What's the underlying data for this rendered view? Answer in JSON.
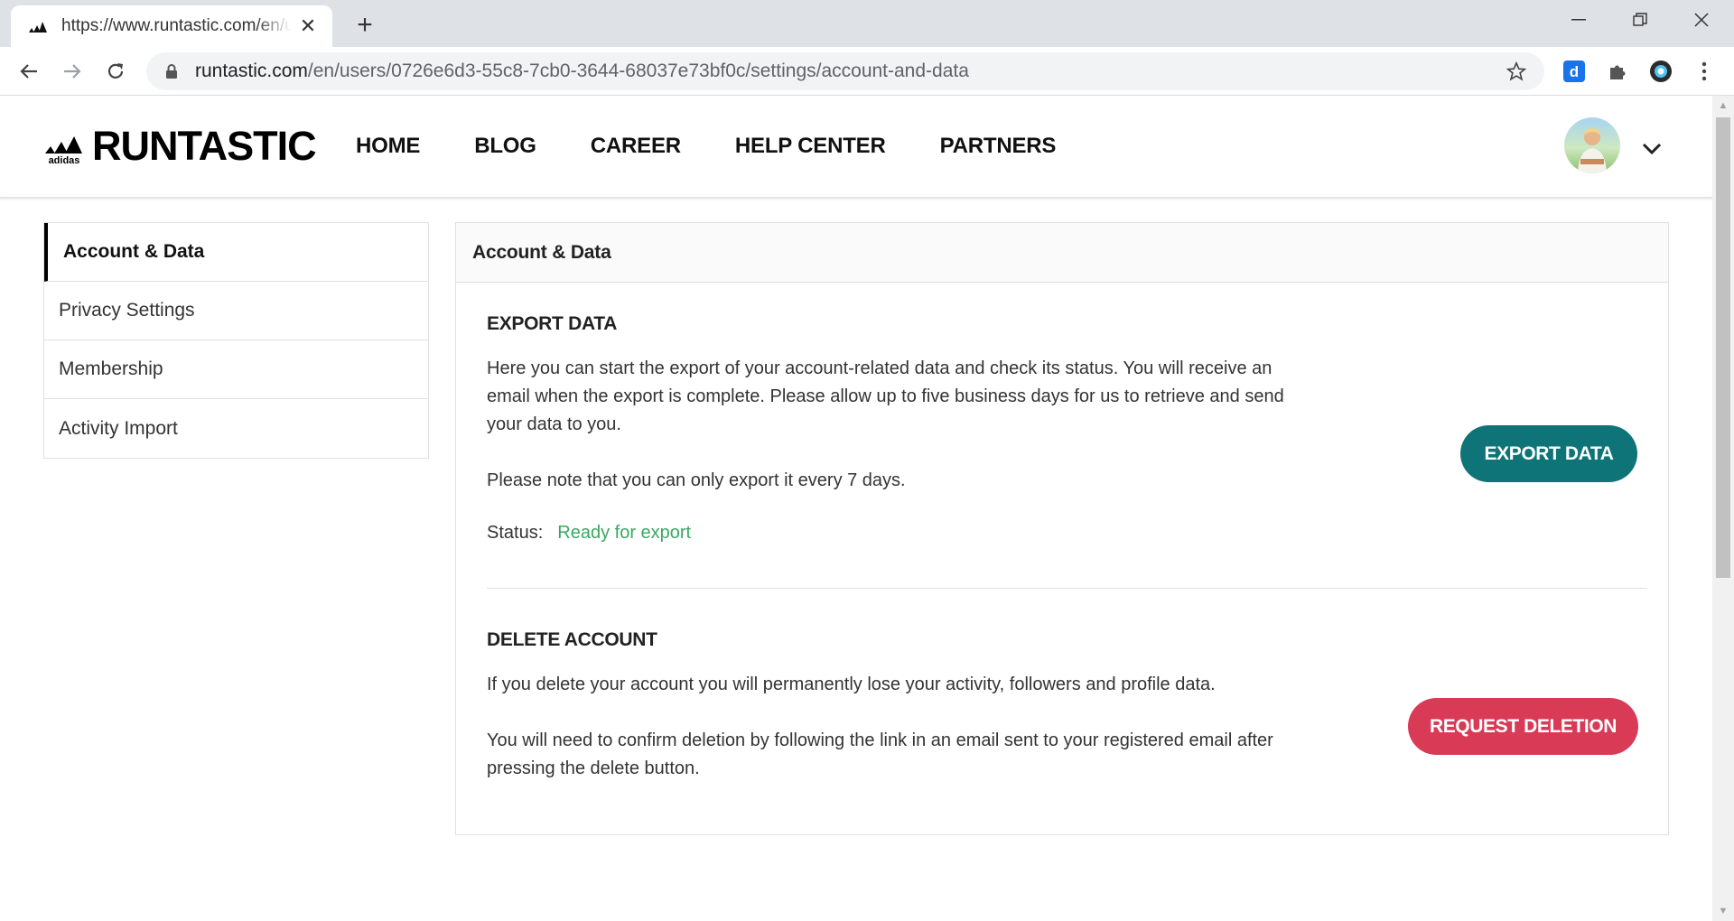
{
  "browser": {
    "tab_title": "https://www.runtastic.com/en/users/0726e6d3",
    "url_host": "runtastic.com",
    "url_path": "/en/users/0726e6d3-55c8-7cb0-3644-68037e73bf0c/settings/account-and-data"
  },
  "header": {
    "logo_brand": "adidas",
    "logo_text": "RUNTASTIC",
    "nav": [
      "HOME",
      "BLOG",
      "CAREER",
      "HELP CENTER",
      "PARTNERS"
    ]
  },
  "sidebar": {
    "items": [
      {
        "label": "Account & Data",
        "active": true
      },
      {
        "label": "Privacy Settings",
        "active": false
      },
      {
        "label": "Membership",
        "active": false
      },
      {
        "label": "Activity Import",
        "active": false
      }
    ]
  },
  "panel": {
    "title": "Account & Data",
    "export": {
      "heading": "EXPORT DATA",
      "paragraph1": "Here you can start the export of your account-related data and check its status. You will receive an email when the export is complete. Please allow up to five business days for us to retrieve and send your data to you.",
      "paragraph2": "Please note that you can only export it every 7 days.",
      "status_label": "Status:",
      "status_value": "Ready for export",
      "button_label": "EXPORT DATA"
    },
    "delete": {
      "heading": "DELETE ACCOUNT",
      "paragraph1": "If you delete your account you will permanently lose your activity, followers and profile data.",
      "paragraph2": "You will need to confirm deletion by following the link in an email sent to your registered email after pressing the delete button.",
      "button_label": "REQUEST DELETION"
    }
  },
  "colors": {
    "export_button": "#0e7478",
    "delete_button": "#d93a56",
    "status_ready": "#3aa860"
  }
}
